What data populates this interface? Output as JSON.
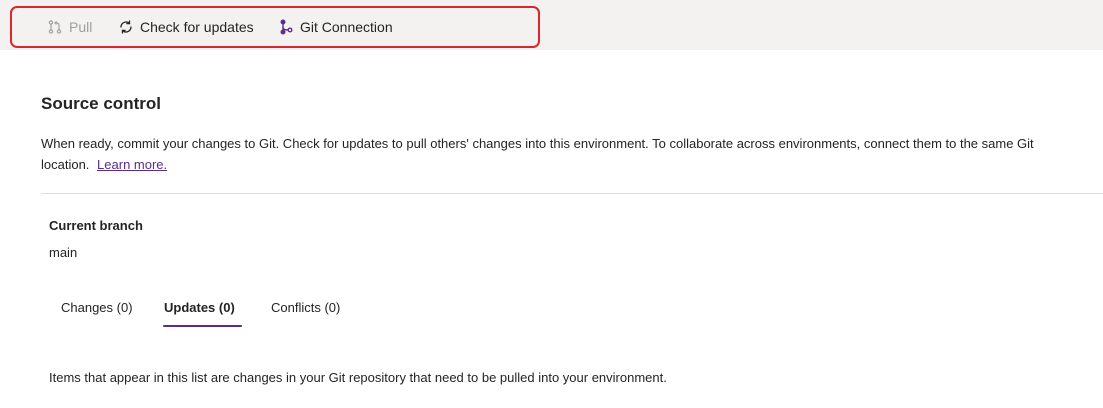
{
  "commandbar": {
    "pull_label": "Pull",
    "check_label": "Check for updates",
    "git_label": "Git Connection"
  },
  "colors": {
    "accent": "#5c2d91",
    "highlight_border": "#d9262f",
    "commandbar_bg": "#f3f2f1"
  },
  "source_control": {
    "title": "Source control",
    "description": "When ready, commit your changes to Git. Check for updates to pull others' changes into this environment. To collaborate across environments, connect them to the same Git location.",
    "learn_more": "Learn more."
  },
  "branch": {
    "label": "Current branch",
    "value": "main"
  },
  "tabs": [
    {
      "label": "Changes (0)"
    },
    {
      "label": "Updates (0)"
    },
    {
      "label": "Conflicts (0)"
    }
  ],
  "info_text": "Items that appear in this list are changes in your Git repository that need to be pulled into your environment.",
  "icons": {
    "pull": "pull-request-icon",
    "check": "refresh-icon",
    "git": "branch-icon"
  }
}
